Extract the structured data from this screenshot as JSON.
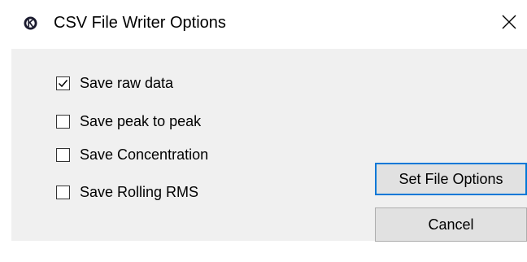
{
  "window": {
    "title": "CSV File Writer Options",
    "app_icon": "app-logo-icon",
    "close_icon": "close-icon"
  },
  "options": [
    {
      "label": "Save raw data",
      "checked": true
    },
    {
      "label": "Save peak to peak",
      "checked": false
    },
    {
      "label": "Save Concentration",
      "checked": false
    },
    {
      "label": "Save Rolling RMS",
      "checked": false
    }
  ],
  "buttons": {
    "set_file_options": "Set File Options",
    "cancel": "Cancel"
  },
  "colors": {
    "accent": "#0078d7",
    "dialog_bg": "#f0f0f0",
    "button_bg": "#e1e1e1"
  }
}
